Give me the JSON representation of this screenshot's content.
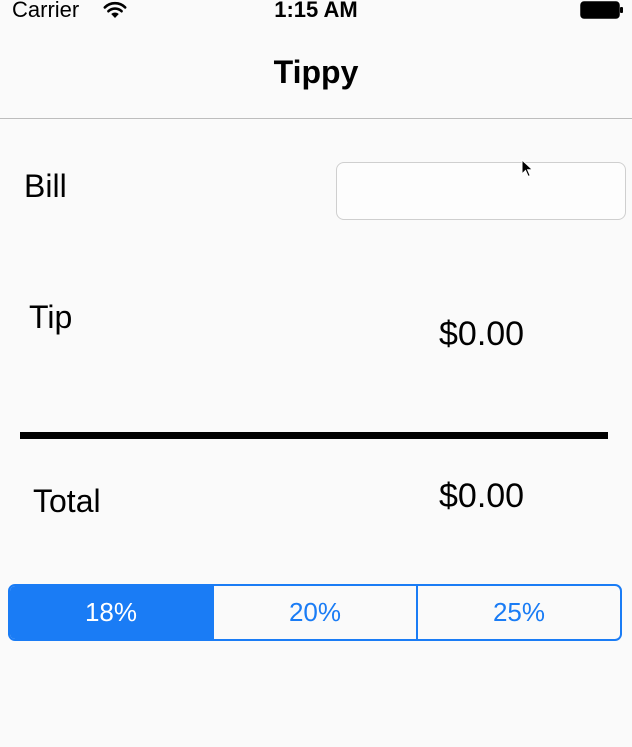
{
  "status_bar": {
    "carrier": "Carrier",
    "time": "1:15 AM",
    "wifi_icon": "wifi-icon",
    "battery_icon": "battery-icon"
  },
  "nav": {
    "title": "Tippy"
  },
  "bill": {
    "label": "Bill",
    "value": "",
    "placeholder": ""
  },
  "tip": {
    "label": "Tip",
    "value": "$0.00"
  },
  "total": {
    "label": "Total",
    "value": "$0.00"
  },
  "tip_percentages": {
    "options": [
      "18%",
      "20%",
      "25%"
    ],
    "selected_index": 0
  },
  "colors": {
    "accent": "#1a7cf5",
    "background": "#fafafa",
    "divider": "#000000"
  }
}
